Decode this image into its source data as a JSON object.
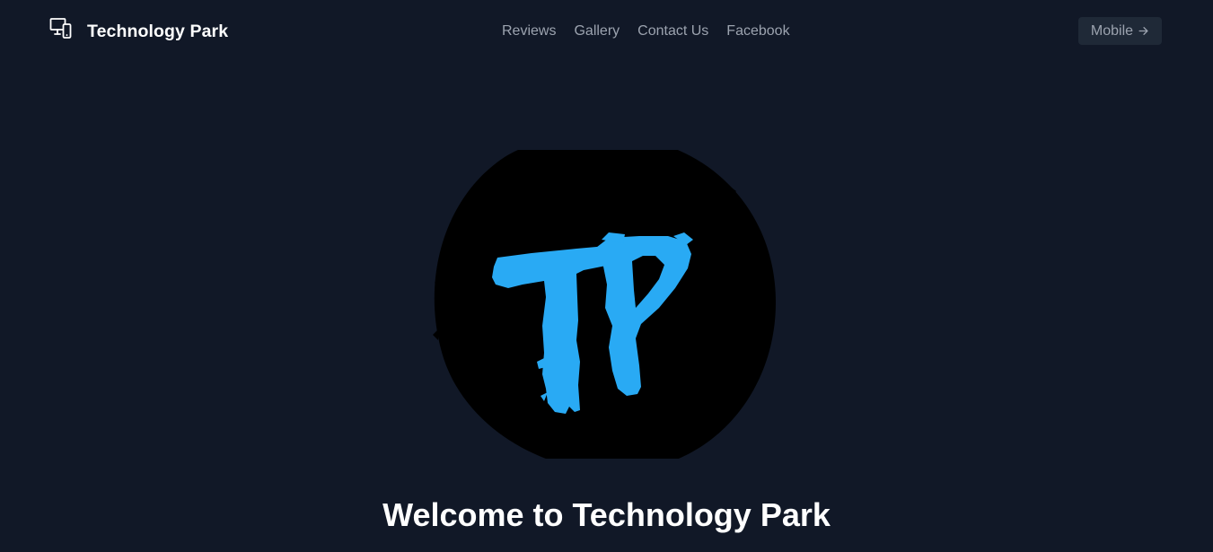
{
  "header": {
    "brand_name": "Technology Park",
    "brand_icon": "devices-icon",
    "nav": [
      {
        "label": "Reviews"
      },
      {
        "label": "Gallery"
      },
      {
        "label": "Contact Us"
      },
      {
        "label": "Facebook"
      }
    ],
    "cta_label": "Mobile",
    "cta_icon": "arrow-right-icon"
  },
  "hero": {
    "logo_text": "TP",
    "title": "Welcome to Technology Park",
    "subtitle": ""
  },
  "colors": {
    "background": "#111827",
    "nav_text": "#9ca3af",
    "button_bg": "#1f2937",
    "logo_circle": "#000000",
    "logo_letters": "#29aaf4"
  }
}
